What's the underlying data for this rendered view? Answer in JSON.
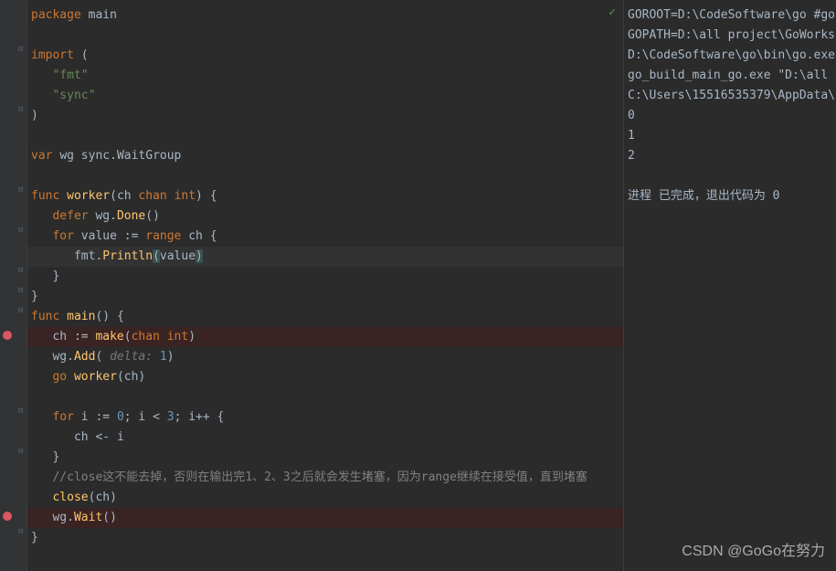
{
  "code": {
    "l1": {
      "package": "package",
      "main": "main"
    },
    "l3": {
      "import": "import",
      "paren": "("
    },
    "l4": {
      "fmt": "\"fmt\""
    },
    "l5": {
      "sync": "\"sync\""
    },
    "l6": {
      "paren": ")"
    },
    "l8": {
      "var": "var",
      "wg": "wg",
      "sync": "sync",
      "dot": ".",
      "WaitGroup": "WaitGroup"
    },
    "l10": {
      "func": "func",
      "worker": "worker",
      "open": "(",
      "ch": "ch",
      "chan": "chan",
      "int": "int",
      "close": ")",
      "brace": "{"
    },
    "l11": {
      "defer": "defer",
      "wg": "wg",
      "dot": ".",
      "Done": "Done",
      "parens": "()"
    },
    "l12": {
      "for": "for",
      "value": "value",
      "assign": ":=",
      "range": "range",
      "ch": "ch",
      "brace": "{"
    },
    "l13": {
      "fmt": "fmt",
      "dot": ".",
      "Println": "Println",
      "open": "(",
      "value": "value",
      "close": ")"
    },
    "l14": {
      "brace": "}"
    },
    "l15": {
      "brace": "}"
    },
    "l16": {
      "func": "func",
      "main": "main",
      "parens": "()",
      "brace": "{"
    },
    "l17": {
      "ch": "ch",
      "assign": ":=",
      "make": "make",
      "open": "(",
      "chan": "chan",
      "int": "int",
      "close": ")"
    },
    "l18": {
      "wg": "wg",
      "dot": ".",
      "Add": "Add",
      "open": "(",
      "hint": " delta: ",
      "one": "1",
      "close": ")"
    },
    "l19": {
      "go": "go",
      "worker": "worker",
      "open": "(",
      "ch": "ch",
      "close": ")"
    },
    "l21": {
      "for": "for",
      "i": "i",
      "assign": ":=",
      "zero": "0",
      "semi1": ";",
      "i2": "i",
      "lt": "<",
      "three": "3",
      "semi2": ";",
      "i3": "i",
      "inc": "++",
      "brace": "{"
    },
    "l22": {
      "ch": "ch",
      "arrow": "<-",
      "i": "i"
    },
    "l23": {
      "brace": "}"
    },
    "l24": {
      "comment": "//close这不能去掉，否则在输出完1、2、3之后就会发生堵塞，因为range继续在接受值，直到堵塞"
    },
    "l25": {
      "close": "close",
      "open": "(",
      "ch": "ch",
      "cparen": ")"
    },
    "l26": {
      "wg": "wg",
      "dot": ".",
      "Wait": "Wait",
      "parens": "()"
    },
    "l27": {
      "brace": "}"
    }
  },
  "console": {
    "l1": "GOROOT=D:\\CodeSoftware\\go #go",
    "l2": "GOPATH=D:\\all project\\GoWorks",
    "l3": "D:\\CodeSoftware\\go\\bin\\go.exe",
    "l4": "go_build_main_go.exe \"D:\\all",
    "l5": "C:\\Users\\15516535379\\AppData\\",
    "l6": "0",
    "l7": "1",
    "l8": "2",
    "l10": "进程  已完成，退出代码为 0"
  },
  "watermark": "CSDN @GoGo在努力",
  "icons": {
    "check": "✓",
    "foldMinus": "⊟",
    "foldPlus": "⊞"
  }
}
